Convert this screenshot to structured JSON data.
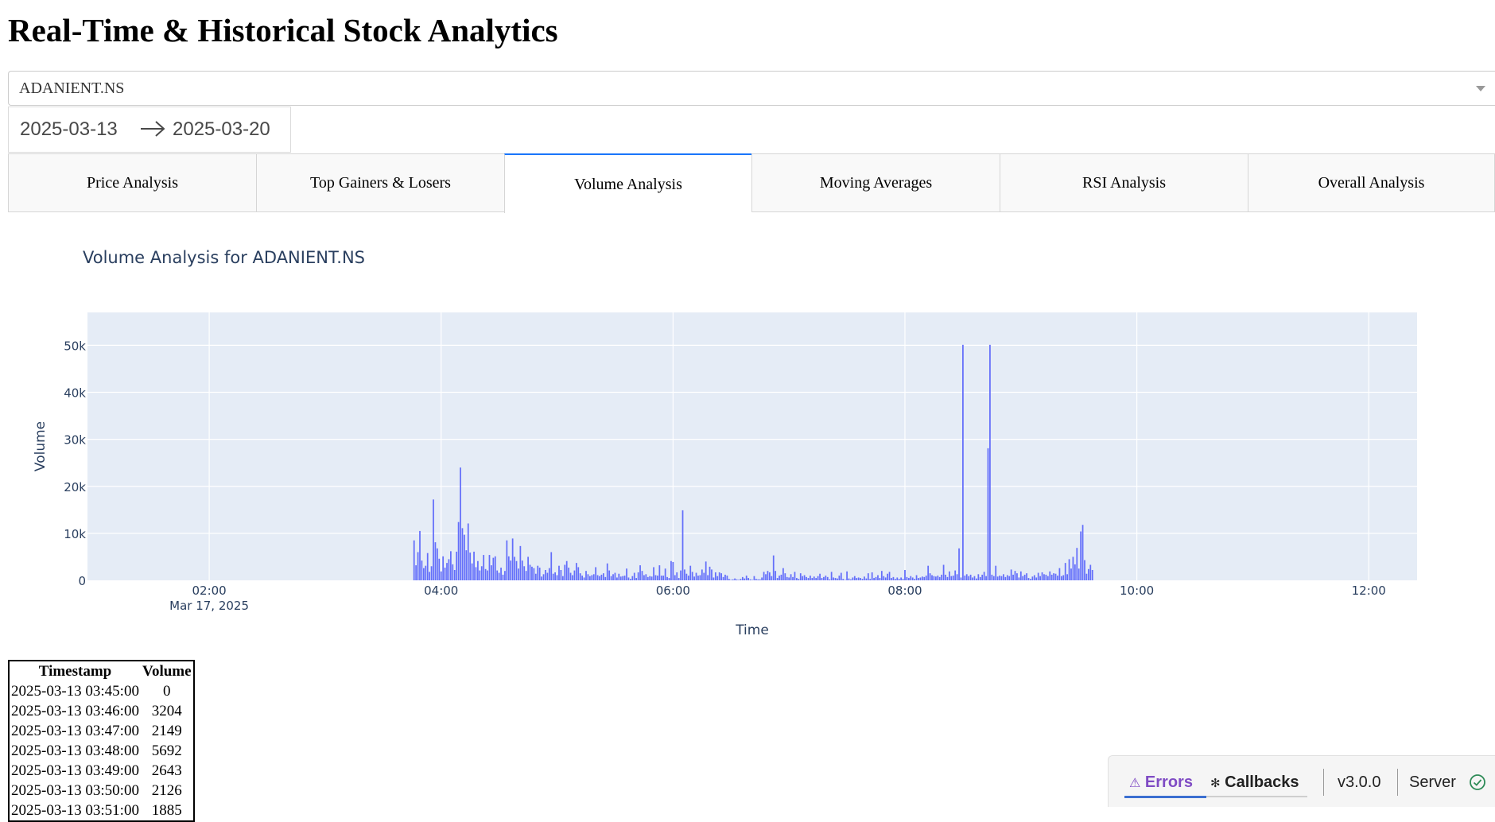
{
  "page": {
    "title": "Real-Time & Historical Stock Analytics"
  },
  "dropdown": {
    "selected": "ADANIENT.NS"
  },
  "daterange": {
    "start": "2025-03-13",
    "end": "2025-03-20"
  },
  "tabs": [
    {
      "label": "Price Analysis",
      "active": false
    },
    {
      "label": "Top Gainers & Losers",
      "active": false
    },
    {
      "label": "Volume Analysis",
      "active": true
    },
    {
      "label": "Moving Averages",
      "active": false
    },
    {
      "label": "RSI Analysis",
      "active": false
    },
    {
      "label": "Overall Analysis",
      "active": false
    }
  ],
  "chart_data": {
    "type": "bar",
    "title": "Volume Analysis for ADANIENT.NS",
    "xlabel": "Time",
    "ylabel": "Volume",
    "ylim": [
      0,
      57000
    ],
    "y_ticks": [
      0,
      10000,
      20000,
      30000,
      40000,
      50000
    ],
    "y_tick_labels": [
      "0",
      "10k",
      "20k",
      "30k",
      "40k",
      "50k"
    ],
    "x_range": [
      "2025-03-17 00:57",
      "2025-03-17 12:25"
    ],
    "x_ticks": [
      {
        "time": "02:00",
        "sublabel": "Mar 17, 2025"
      },
      {
        "time": "04:00",
        "sublabel": ""
      },
      {
        "time": "06:00",
        "sublabel": ""
      },
      {
        "time": "08:00",
        "sublabel": ""
      },
      {
        "time": "10:00",
        "sublabel": ""
      },
      {
        "time": "12:00",
        "sublabel": ""
      }
    ],
    "bar_color": "#636efa",
    "plot_bgcolor": "#e5ecf6",
    "series": [
      {
        "start": "2025-03-17 03:45",
        "interval_minutes": 1,
        "values": [
          0,
          8500,
          3200,
          6000,
          10500,
          4200,
          2600,
          3100,
          5800,
          1800,
          3000,
          17200,
          8100,
          6800,
          4600,
          1900,
          5100,
          2700,
          3700,
          4500,
          6200,
          3400,
          2200,
          6100,
          12400,
          24000,
          11100,
          9700,
          6400,
          12100,
          5900,
          3600,
          6100,
          2800,
          4100,
          2100,
          3000,
          5400,
          2400,
          2100,
          5400,
          3200,
          4800,
          5100,
          2100,
          1600,
          2700,
          1200,
          2000,
          8500,
          5100,
          4200,
          8900,
          5000,
          4100,
          2500,
          7300,
          4200,
          3000,
          2000,
          5000,
          3300,
          2900,
          2600,
          1400,
          3100,
          2700,
          800,
          1300,
          2200,
          1600,
          2600,
          6000,
          1400,
          1700,
          1100,
          3100,
          2200,
          900,
          3300,
          4100,
          2700,
          1600,
          1100,
          2100,
          3700,
          2800,
          1500,
          1000,
          600,
          2000,
          1300,
          900,
          1100,
          1300,
          2800,
          1100,
          900,
          1200,
          1500,
          700,
          3600,
          2100,
          900,
          1300,
          1600,
          600,
          1400,
          800,
          900,
          1000,
          2500,
          600,
          300,
          900,
          1600,
          500,
          1700,
          3200,
          2000,
          1100,
          1300,
          700,
          900,
          800,
          2800,
          1100,
          1000,
          3200,
          1000,
          1000,
          2500,
          700,
          500,
          4100,
          3900,
          1100,
          1700,
          500,
          2100,
          14900,
          2300,
          1400,
          1000,
          3100,
          1800,
          800,
          1600,
          1000,
          1100,
          2300,
          1600,
          4000,
          1100,
          2900,
          2300,
          600,
          1700,
          900,
          1700,
          1500,
          700,
          1200,
          1000,
          300,
          100,
          200,
          400,
          200,
          100,
          300,
          700,
          400,
          1000,
          500,
          200,
          100,
          900,
          300,
          200,
          200,
          600,
          1800,
          1300,
          2000,
          1700,
          900,
          5300,
          2000,
          500,
          1000,
          1200,
          2600,
          1500,
          700,
          600,
          1300,
          700,
          1800,
          500,
          300,
          1500,
          900,
          1100,
          700,
          500,
          1000,
          500,
          800,
          500,
          900,
          1400,
          500,
          700,
          1000,
          700,
          200,
          1800,
          600,
          500,
          400,
          1000,
          1600,
          300,
          100,
          1900,
          400,
          200,
          600,
          900,
          500,
          600,
          500,
          300,
          800,
          400,
          1500,
          300,
          1700,
          500,
          700,
          1100,
          500,
          2000,
          900,
          600,
          1400,
          1800,
          500,
          700,
          300,
          600,
          300,
          600,
          300,
          2200,
          700,
          500,
          900,
          600,
          300,
          1100,
          500,
          600,
          800,
          700,
          1000,
          3100,
          1500,
          1100,
          900,
          800,
          1000,
          700,
          1200,
          3300,
          1200,
          700,
          1900,
          900,
          1000,
          2100,
          1300,
          6800,
          600,
          50100,
          1000,
          1300,
          900,
          1200,
          600,
          900,
          400,
          1300,
          700,
          1200,
          1800,
          900,
          28100,
          50100,
          1200,
          900,
          3100,
          800,
          1000,
          900,
          1300,
          700,
          1100,
          900,
          2300,
          1200,
          2000,
          1500,
          600,
          1900,
          900,
          1200,
          1500,
          500,
          300,
          800,
          1100,
          600,
          1600,
          900,
          1700,
          1300,
          1200,
          900,
          1900,
          1200,
          1500,
          1400,
          1000,
          2600,
          900,
          1100,
          3700,
          1300,
          4500,
          2500,
          5000,
          3400,
          6900,
          2500,
          10400,
          11800,
          4300,
          1400,
          2400,
          3300,
          2200
        ]
      }
    ]
  },
  "table": {
    "headers": [
      "Timestamp",
      "Volume"
    ],
    "rows": [
      [
        "2025-03-13 03:45:00",
        "0"
      ],
      [
        "2025-03-13 03:46:00",
        "3204"
      ],
      [
        "2025-03-13 03:47:00",
        "2149"
      ],
      [
        "2025-03-13 03:48:00",
        "5692"
      ],
      [
        "2025-03-13 03:49:00",
        "2643"
      ],
      [
        "2025-03-13 03:50:00",
        "2126"
      ],
      [
        "2025-03-13 03:51:00",
        "1885"
      ]
    ]
  },
  "devtools": {
    "errors_label": "Errors",
    "callbacks_label": "Callbacks",
    "version": "v3.0.0",
    "server_label": "Server",
    "errors_icon": "warning-icon",
    "callbacks_icon": "callbacks-icon",
    "server_icon": "check-circle-icon",
    "accent": "#7f4bc4",
    "ok_color": "#2e8b57"
  }
}
